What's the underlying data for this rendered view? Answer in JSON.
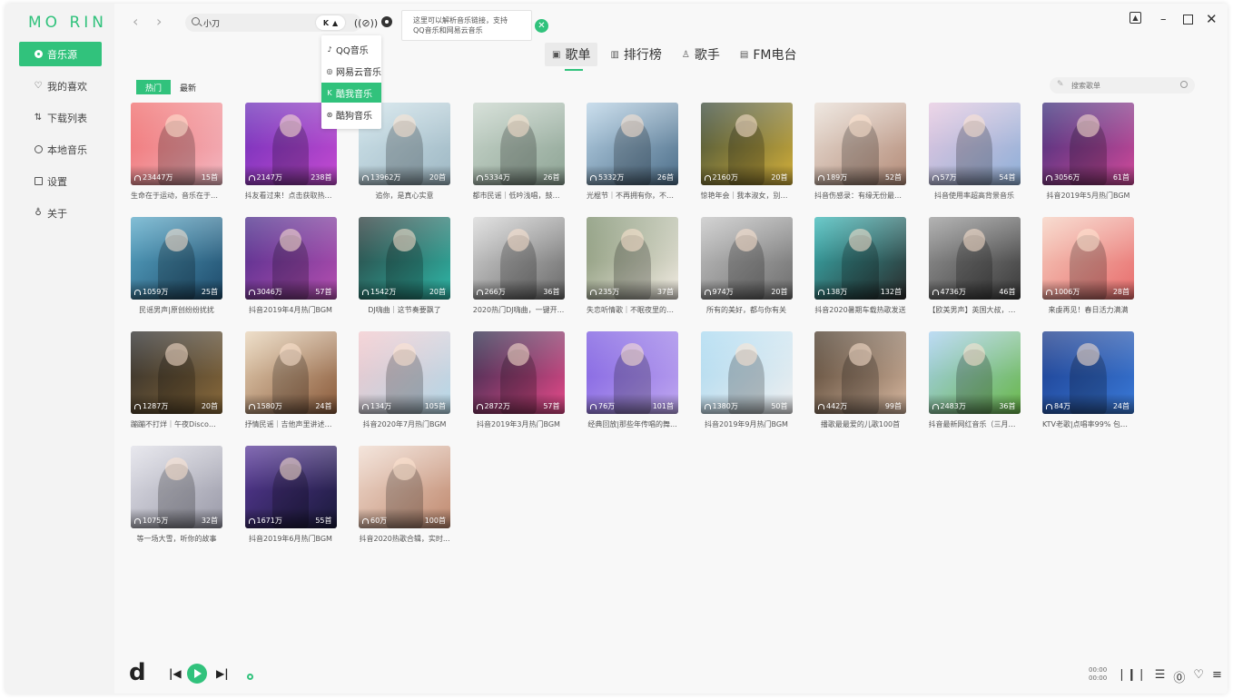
{
  "app": {
    "logo": "MO RIN",
    "accent": "#31c27c"
  },
  "sidebar": {
    "items": [
      {
        "label": "音乐源",
        "icon": "source-icon",
        "active": true
      },
      {
        "label": "我的喜欢",
        "icon": "heart-icon"
      },
      {
        "label": "下载列表",
        "icon": "download-icon"
      },
      {
        "label": "本地音乐",
        "icon": "local-music-icon"
      },
      {
        "label": "设置",
        "icon": "settings-icon"
      },
      {
        "label": "关于",
        "icon": "info-icon"
      }
    ]
  },
  "topbar": {
    "search_value": "小刀",
    "source_badge": "K",
    "tooltip": {
      "line1": "这里可以解析音乐链接，支持",
      "line2": "QQ音乐和网易云音乐"
    },
    "close_glyph": "✕"
  },
  "source_dropdown": {
    "items": [
      {
        "label": "QQ音乐",
        "glyph": "♪"
      },
      {
        "label": "网易云音乐",
        "glyph": "◎"
      },
      {
        "label": "酷我音乐",
        "glyph": "K",
        "active": true
      },
      {
        "label": "酷狗音乐",
        "glyph": "⊛"
      }
    ]
  },
  "tabs": [
    {
      "label": "歌单",
      "glyph": "▣",
      "active": true
    },
    {
      "label": "排行榜",
      "glyph": "▥"
    },
    {
      "label": "歌手",
      "glyph": "♙"
    },
    {
      "label": "FM电台",
      "glyph": "▤"
    }
  ],
  "subtabs": {
    "hot": "热门",
    "new": "最新"
  },
  "list_search": {
    "placeholder": "搜索歌单"
  },
  "playlists": [
    {
      "plays": "23447万",
      "count": "15首",
      "title": "生命在于运动，音乐在于节...",
      "c1": "#f06b6b",
      "c2": "#f2b8c2"
    },
    {
      "plays": "2147万",
      "count": "238首",
      "title": "抖友看过来！点击获取热门...",
      "c1": "#6b2fb8",
      "c2": "#c64bd1"
    },
    {
      "plays": "13962万",
      "count": "20首",
      "title": "追你，是真心实意",
      "c1": "#cfe3ea",
      "c2": "#9fb8c4"
    },
    {
      "plays": "5334万",
      "count": "26首",
      "title": "都市民谣｜低吟浅唱，鼓动...",
      "c1": "#c9d6cc",
      "c2": "#8fa596"
    },
    {
      "plays": "5332万",
      "count": "26首",
      "title": "光棍节｜不再拥有你，不知...",
      "c1": "#b9d3e6",
      "c2": "#4e6f8a"
    },
    {
      "plays": "2160万",
      "count": "20首",
      "title": "惊艳年会｜我本淑女，别逼...",
      "c1": "#3a4a3a",
      "c2": "#d4b03a"
    },
    {
      "plays": "189万",
      "count": "52首",
      "title": "抖音伤感录：有缘无份最是...",
      "c1": "#e9dfd6",
      "c2": "#b58d7a"
    },
    {
      "plays": "57万",
      "count": "54首",
      "title": "抖音使用率超高背景音乐",
      "c1": "#e6c8e0",
      "c2": "#8fb0d8"
    },
    {
      "plays": "3056万",
      "count": "61首",
      "title": "抖音2019年5月热门BGM",
      "c1": "#3b2f7a",
      "c2": "#d24a9a"
    },
    {
      "plays": "1059万",
      "count": "25首",
      "title": "民谣男声|原创纷纷扰扰",
      "c1": "#5aa9c8",
      "c2": "#1e4a6a"
    },
    {
      "plays": "3046万",
      "count": "57首",
      "title": "抖音2019年4月热门BGM",
      "c1": "#4a2c8a",
      "c2": "#b64fb0"
    },
    {
      "plays": "1542万",
      "count": "20首",
      "title": "DJ嗨曲｜这节奏要飘了",
      "c1": "#2a3a3a",
      "c2": "#2fb8a8"
    },
    {
      "plays": "266万",
      "count": "36首",
      "title": "2020热门DJ嗨曲，一键开...",
      "c1": "#d8d8d8",
      "c2": "#6a6a6a"
    },
    {
      "plays": "235万",
      "count": "37首",
      "title": "失恋听情歌｜不眠夜里的孤...",
      "c1": "#7a8c6a",
      "c2": "#f3ede4"
    },
    {
      "plays": "974万",
      "count": "20首",
      "title": "所有的美好，都与你有关",
      "c1": "#c4c4c4",
      "c2": "#6e6e6e"
    },
    {
      "plays": "138万",
      "count": "132首",
      "title": "抖音2020暑期车载热歌发送",
      "c1": "#3ab8b8",
      "c2": "#2a2a2a"
    },
    {
      "plays": "4736万",
      "count": "46首",
      "title": "【欧美男声】英国大叔，是...",
      "c1": "#9a9a9a",
      "c2": "#3a3a3a"
    },
    {
      "plays": "1006万",
      "count": "28首",
      "title": "来虔再见！春日活力满满",
      "c1": "#f6d0c0",
      "c2": "#e86c6c"
    },
    {
      "plays": "1287万",
      "count": "20首",
      "title": "蹦蹦不打烊｜午夜Disco专场",
      "c1": "#2a2a2a",
      "c2": "#8a6a3a"
    },
    {
      "plays": "1580万",
      "count": "24首",
      "title": "抒情民谣｜吉他声里讲述的...",
      "c1": "#e8d4b8",
      "c2": "#8a5a3a"
    },
    {
      "plays": "134万",
      "count": "105首",
      "title": "抖音2020年7月热门BGM",
      "c1": "#f2c8cc",
      "c2": "#b4d8e8"
    },
    {
      "plays": "2872万",
      "count": "57首",
      "title": "抖音2019年3月热门BGM",
      "c1": "#2a2a4a",
      "c2": "#e84a8a"
    },
    {
      "plays": "76万",
      "count": "101首",
      "title": "经典回放|那些年传唱的舞...",
      "c1": "#7a5ae0",
      "c2": "#c0a8f0"
    },
    {
      "plays": "1380万",
      "count": "50首",
      "title": "抖音2019年9月热门BGM",
      "c1": "#a8d8f0",
      "c2": "#f0f0f0"
    },
    {
      "plays": "442万",
      "count": "99首",
      "title": "播歌最最爱的儿歌100首",
      "c1": "#4a3a2a",
      "c2": "#d8b8a0"
    },
    {
      "plays": "2483万",
      "count": "36首",
      "title": "抖音最新网红音乐（三月更...",
      "c1": "#a8d0f0",
      "c2": "#6ab84a"
    },
    {
      "plays": "84万",
      "count": "24首",
      "title": "KTV老歌|点唱率99% 包厢...",
      "c1": "#1a3a8a",
      "c2": "#3a7ad8"
    },
    {
      "plays": "1075万",
      "count": "32首",
      "title": "等一场大雪，听你的故事",
      "c1": "#e0e0e8",
      "c2": "#9a9aa8"
    },
    {
      "plays": "1671万",
      "count": "55首",
      "title": "抖音2019年6月热门BGM",
      "c1": "#5a3a9a",
      "c2": "#1a1a3a"
    },
    {
      "plays": "60万",
      "count": "100首",
      "title": "抖音2020热歌合辑，实时...",
      "c1": "#f0dcd0",
      "c2": "#c08a70"
    }
  ],
  "player": {
    "logo": "d",
    "time_current": "00:00",
    "time_total": "00:00"
  }
}
